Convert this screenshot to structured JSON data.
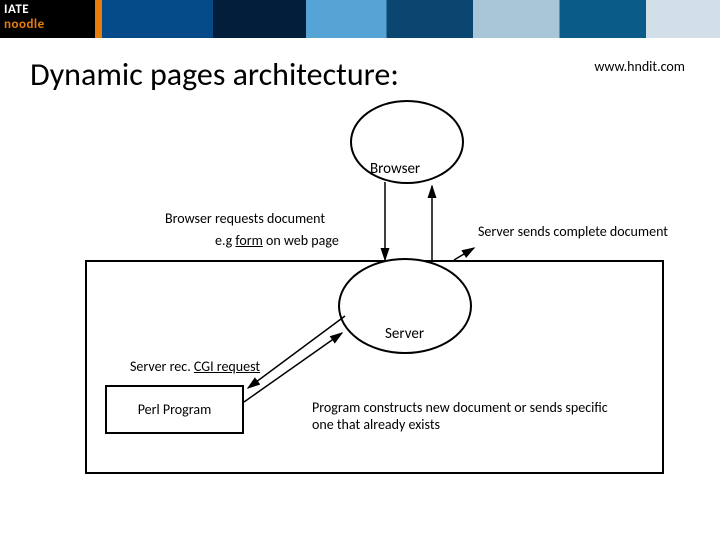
{
  "header": {
    "logo_line1": "IATE",
    "logo_line2": "noodle"
  },
  "title": "Dynamic pages architecture:",
  "url": "www.hndit.com",
  "labels": {
    "browser": "Browser",
    "req_l1": "Browser requests document",
    "req_l2_pre": "e.g ",
    "req_l2_u": "form",
    "req_l2_post": " on web page",
    "sends": "Server sends complete document",
    "server": "Server",
    "cgi_pre": "Server rec. ",
    "cgi_u": "CGI request",
    "perl": "Perl Program",
    "prog": "Program constructs new document or sends specific one that already exists"
  }
}
